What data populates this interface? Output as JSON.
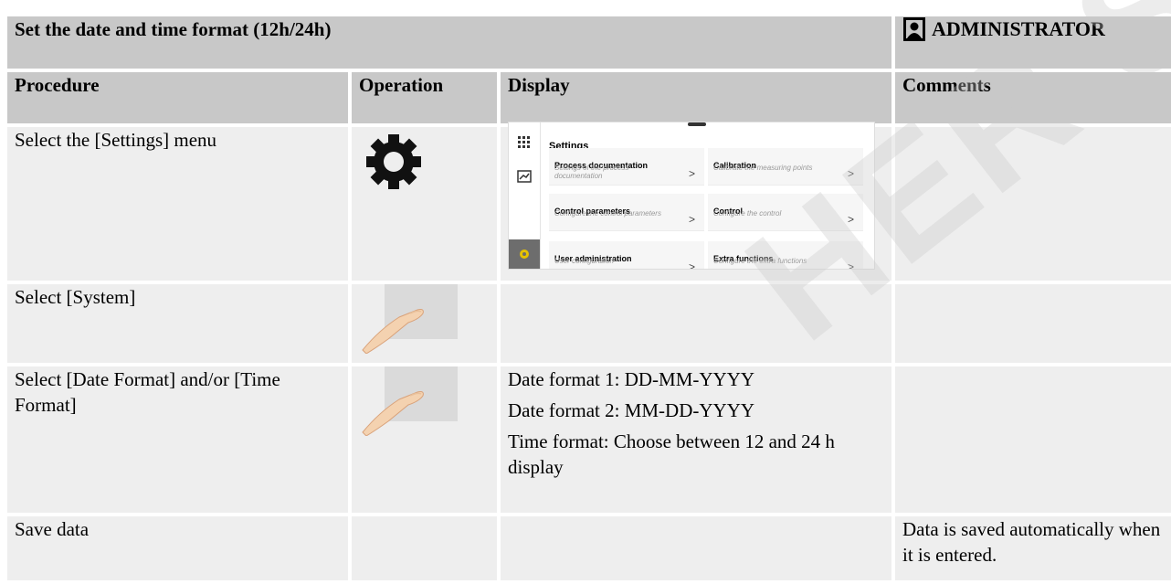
{
  "header": {
    "title": "Set the date and time format (12h/24h)",
    "role": "ADMINISTRATOR",
    "role_icon": "person-icon"
  },
  "columns": [
    "Procedure",
    "Operation",
    "Display",
    "Comments"
  ],
  "rows": [
    {
      "procedure": "Select the [Settings] menu",
      "operation_icon": "gear-icon",
      "comments": ""
    },
    {
      "procedure": "Select [System]",
      "operation_icon": "finger-tap-icon",
      "comments": ""
    },
    {
      "procedure": "Select [Date Format] and/or [Time Format]",
      "operation_icon": "finger-tap-icon",
      "display_lines": [
        "Date format 1: DD-MM-YYYY",
        "Date format 2: MM-DD-YYYY",
        "Time format: Choose between 12 and 24 h display"
      ],
      "comments": ""
    },
    {
      "procedure": "Save data",
      "operation_icon": "",
      "comments": "Data is saved automatically when it is entered."
    }
  ],
  "mini_screen": {
    "title": "Settings",
    "cards": [
      {
        "title": "Process documentation",
        "subtitle": "Settings of the process documentation"
      },
      {
        "title": "Calibration",
        "subtitle": "Calibrate the measuring points"
      },
      {
        "title": "Control parameters",
        "subtitle": "Configure the control parameters"
      },
      {
        "title": "Control",
        "subtitle": "Configure the control"
      },
      {
        "title": "User administration",
        "subtitle": "User configuration"
      },
      {
        "title": "Extra functions",
        "subtitle": "Configure the extra functions"
      }
    ],
    "chevron": ">"
  },
  "watermark": "HER SAS"
}
